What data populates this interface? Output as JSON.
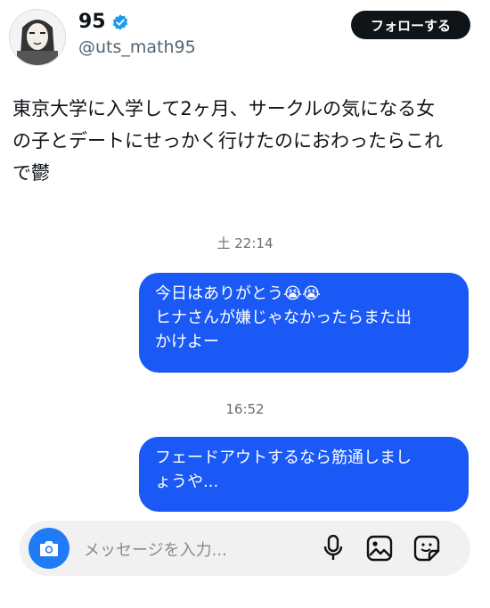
{
  "header": {
    "display_name": "95",
    "handle": "@uts_math95",
    "follow_label": "フォローする"
  },
  "tweet": {
    "lines": [
      "東京大学に入学して2ヶ月、サークルの気になる女",
      "の子とデートにせっかく行けたのにおわったらこれ",
      "で鬱"
    ]
  },
  "chat": {
    "timestamp1": "土 22:14",
    "bubble1_lines": [
      "今日はありがとう😭😭",
      "ヒナさんが嫌じゃなかったらまた出",
      "かけよー"
    ],
    "timestamp2": "16:52",
    "bubble2_lines": [
      "フェードアウトするなら筋通しまし",
      "ょうや..."
    ]
  },
  "composer": {
    "placeholder": "メッセージを入力..."
  },
  "colors": {
    "bubble": "#1a59f5",
    "camera": "#1f7cf6",
    "verified": "#1d9bf0"
  },
  "icons": [
    "avatar-image",
    "verified-badge-icon",
    "camera-icon",
    "microphone-icon",
    "image-icon",
    "sticker-icon"
  ]
}
